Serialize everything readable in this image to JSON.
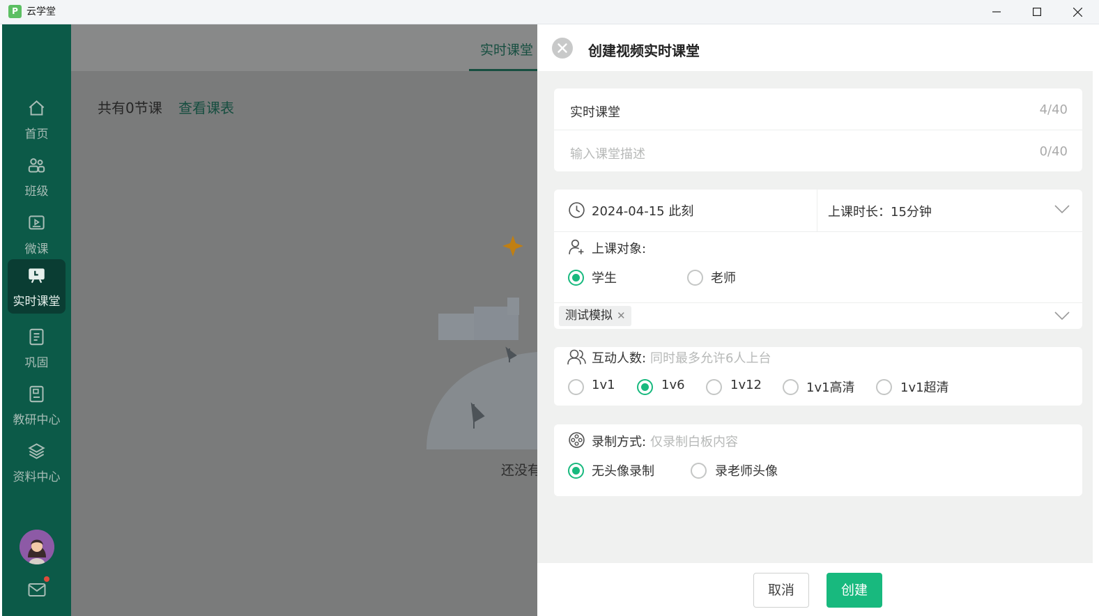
{
  "window": {
    "title": "云学堂",
    "logo_glyph": "P"
  },
  "sidebar": {
    "items": [
      {
        "label": "首页",
        "icon": "home-icon"
      },
      {
        "label": "班级",
        "icon": "users-icon"
      },
      {
        "label": "微课",
        "icon": "video-lesson-icon"
      },
      {
        "label": "实时课堂",
        "icon": "live-class-icon",
        "active": true
      },
      {
        "label": "巩固",
        "icon": "notebook-icon"
      },
      {
        "label": "教研中心",
        "icon": "research-icon"
      },
      {
        "label": "资料中心",
        "icon": "layers-icon"
      }
    ],
    "has_unread_mail": true
  },
  "main": {
    "tab": "实时课堂",
    "lesson_count": "共有0节课",
    "schedule_link": "查看课表",
    "empty_text": "还没有"
  },
  "panel": {
    "title": "创建视频实时课堂",
    "name_value": "实时课堂",
    "name_counter": "4/40",
    "desc_placeholder": "输入课堂描述",
    "desc_counter": "0/40",
    "datetime": "2024-04-15 此刻",
    "duration": "上课时长：15分钟",
    "audience_label": "上课对象:",
    "audience_options": [
      "学生",
      "老师"
    ],
    "audience_selected": "学生",
    "class_tag": "测试模拟",
    "interact_label": "互动人数:",
    "interact_hint": "同时最多允许6人上台",
    "interact_options": [
      "1v1",
      "1v6",
      "1v12",
      "1v1高清",
      "1v1超清"
    ],
    "interact_selected": "1v6",
    "record_label": "录制方式:",
    "record_hint": "仅录制白板内容",
    "record_options": [
      "无头像录制",
      "录老师头像"
    ],
    "record_selected": "无头像录制",
    "cancel_label": "取消",
    "create_label": "创建"
  },
  "colors": {
    "sidebar": "#0c5a48",
    "accent": "#18b97e",
    "brand_dark": "#164e40"
  }
}
